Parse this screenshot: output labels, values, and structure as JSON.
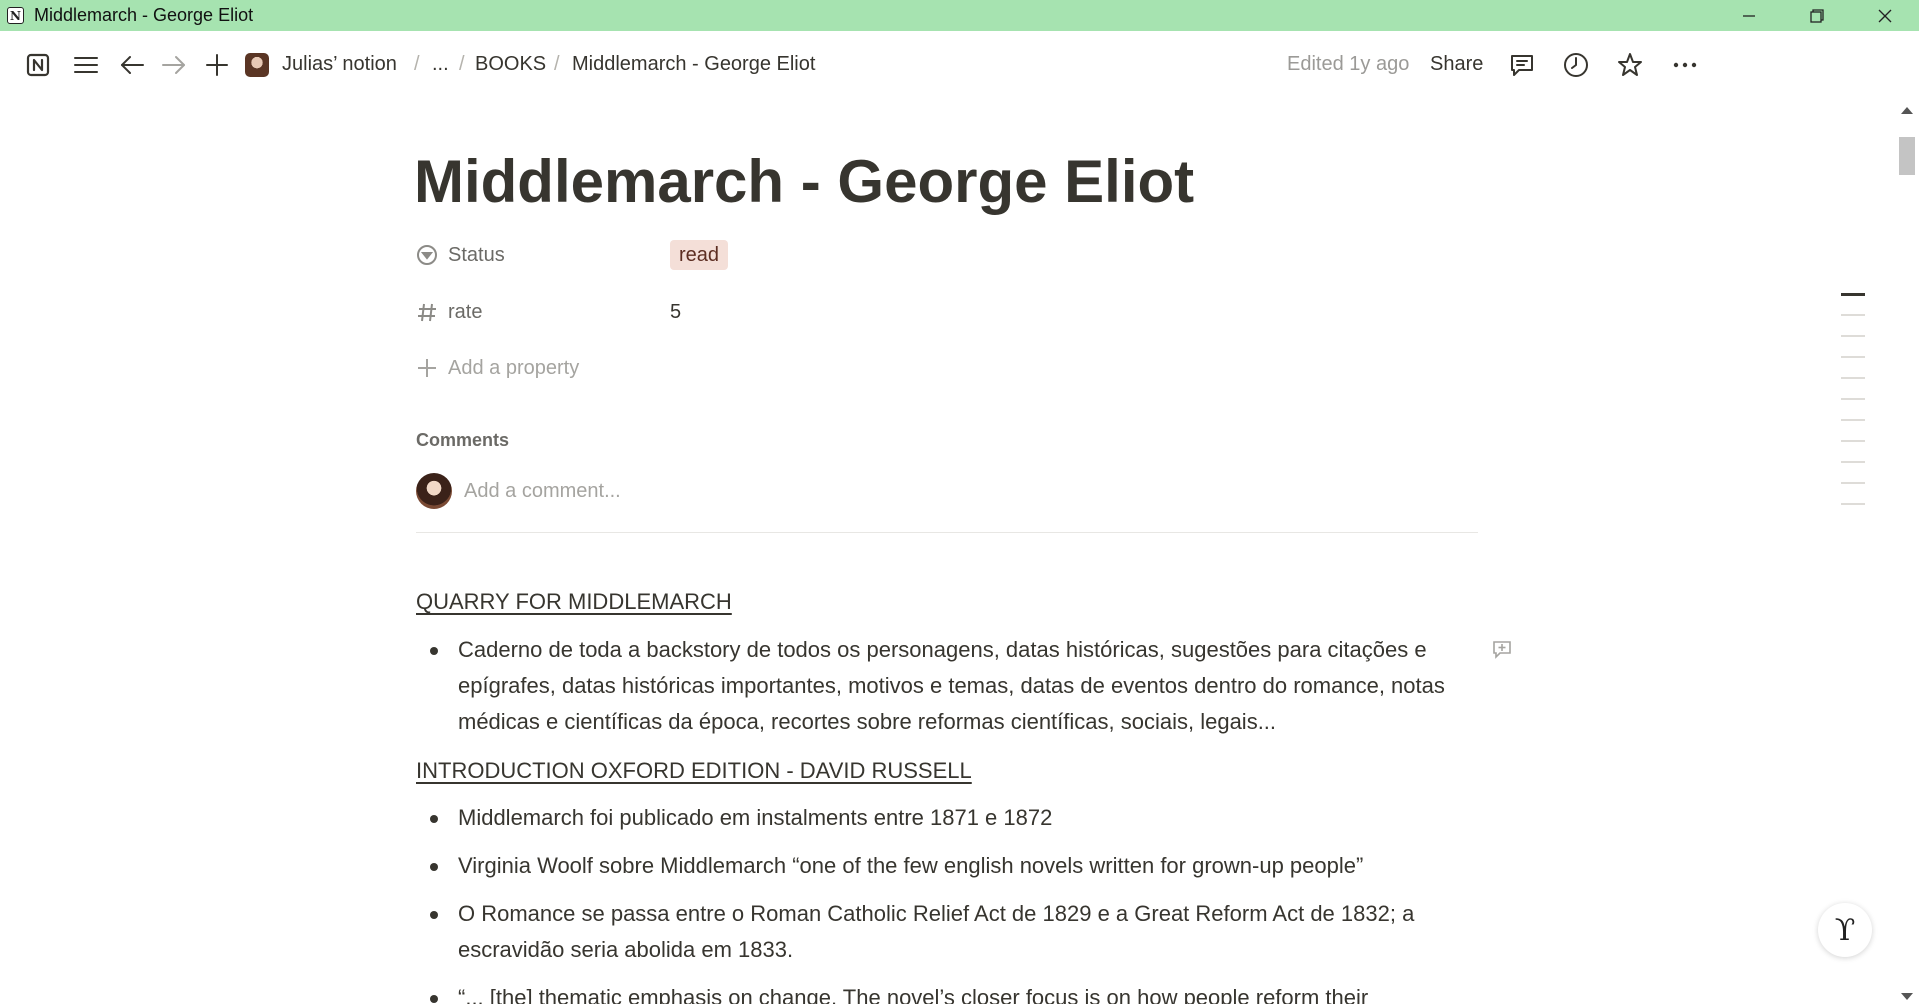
{
  "window": {
    "title": "Middlemarch - George Eliot",
    "titlebar_color": "#a6e3b0",
    "controls": [
      "minimize-icon",
      "restore-icon",
      "close-icon"
    ]
  },
  "topbar": {
    "breadcrumbs": [
      {
        "label": "Julias’ notion"
      },
      {
        "label": "..."
      },
      {
        "label": "BOOKS"
      },
      {
        "label": "Middlemarch - George Eliot"
      }
    ],
    "separator": "/",
    "edited": "Edited 1y ago",
    "share_label": "Share",
    "icons": [
      "notion-logo-icon",
      "menu-icon",
      "back-arrow-icon",
      "forward-arrow-icon",
      "plus-icon",
      "comment-icon",
      "clock-icon",
      "star-icon",
      "more-icon"
    ]
  },
  "page": {
    "title": "Middlemarch - George Eliot",
    "properties": [
      {
        "name": "Status",
        "icon": "status-icon",
        "value": "read",
        "tag_color": "#f4dfd8"
      },
      {
        "name": "rate",
        "icon": "hash-icon",
        "value": "5"
      }
    ],
    "add_property": "Add a property",
    "comments": {
      "label": "Comments",
      "placeholder": "Add a comment..."
    },
    "sections": [
      {
        "heading": "QUARRY FOR MIDDLEMARCH",
        "bullets": [
          "Caderno de toda a backstory de todos os personagens, datas históricas, sugestões para citações e epígrafes, datas históricas importantes, motivos e temas, datas de eventos dentro do romance, notas médicas e científicas da época, recortes sobre reformas científicas, sociais, legais..."
        ]
      },
      {
        "heading": "INTRODUCTION OXFORD EDITION - DAVID RUSSELL",
        "bullets": [
          "Middlemarch foi publicado em instalments entre 1871 e 1872",
          "Virginia Woolf sobre Middlemarch “one of the few english novels written for grown-up people”",
          "O Romance se passa entre o Roman Catholic Relief Act de 1829 e a Great Reform Act de 1832; a escravidão seria abolida em 1833.",
          "“... [the] thematic emphasis on change. The novel’s closer focus is on how people reform their"
        ]
      }
    ]
  },
  "help_button": {
    "icon": "help-icon"
  }
}
